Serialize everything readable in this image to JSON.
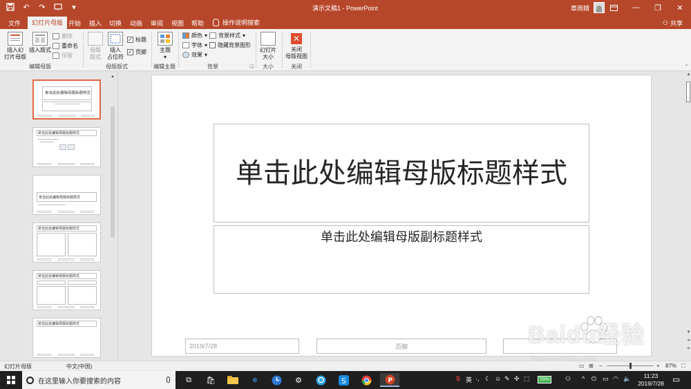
{
  "window": {
    "title": "演示文稿1 - PowerPoint",
    "user_name": "章雨婧",
    "qat": [
      "save-icon",
      "undo-icon",
      "redo-icon",
      "present-icon",
      "customize-icon"
    ],
    "controls": [
      "ribbon-display-icon",
      "minimize-icon",
      "restore-icon",
      "close-icon"
    ]
  },
  "tabs": [
    {
      "label": "文件"
    },
    {
      "label": "幻灯片母版",
      "active": true
    },
    {
      "label": "开始"
    },
    {
      "label": "插入"
    },
    {
      "label": "切换"
    },
    {
      "label": "动画"
    },
    {
      "label": "审阅"
    },
    {
      "label": "视图"
    },
    {
      "label": "帮助"
    }
  ],
  "tell_me": "操作说明搜索",
  "share": "共享",
  "ribbon": {
    "edit_master": {
      "label": "编辑母版",
      "insert_slide_master": "插入幻\n灯片母版",
      "insert_layout": "插入版式",
      "delete": "删除",
      "rename": "重命名",
      "preserve": "保留"
    },
    "master_layout": {
      "label": "母版版式",
      "master_layout_btn": "母版\n版式",
      "insert_placeholder": "插入\n占位符",
      "title_check": "标题",
      "footer_check": "页脚"
    },
    "edit_theme": {
      "label": "编辑主题",
      "themes": "主题"
    },
    "background": {
      "label": "背景",
      "colors": "颜色",
      "fonts": "字体",
      "effects": "效果",
      "bg_styles": "背景样式",
      "hide_bg": "隐藏背景图形"
    },
    "size": {
      "label": "大小",
      "slide_size": "幻灯片\n大小"
    },
    "close": {
      "label": "关闭",
      "close_master": "关闭\n母版视图"
    }
  },
  "thumbnails": [
    {
      "title": "单击此处编辑母版标题样式",
      "selected": true
    },
    {
      "title": "单击此处编辑母版标题样式"
    },
    {
      "title": "单击此处编辑母版标题样式"
    },
    {
      "title": "单击此处编辑母版标题样式"
    },
    {
      "title": "单击此处编辑母版标题样式"
    },
    {
      "title": "单击此处编辑母版标题样式"
    }
  ],
  "slide": {
    "title": "单击此处编辑母版标题样式",
    "subtitle": "单击此处编辑母版副标题样式",
    "date": "2019/7/28",
    "footer": "页脚"
  },
  "status": {
    "view": "幻灯片母版",
    "language": "中文(中国)",
    "zoom": "87%",
    "zoom_fraction": 0.5
  },
  "taskbar": {
    "search_placeholder": "在这里输入你要搜索的内容",
    "ime": "英",
    "battery": "59%",
    "time": "11:23",
    "date": "2019/7/28"
  },
  "watermark": {
    "brand": "Baidu经验",
    "url": "jingyan.baidu.com"
  },
  "colors": {
    "accent": "#b7472a",
    "selected_thumb": "#e2673f"
  }
}
